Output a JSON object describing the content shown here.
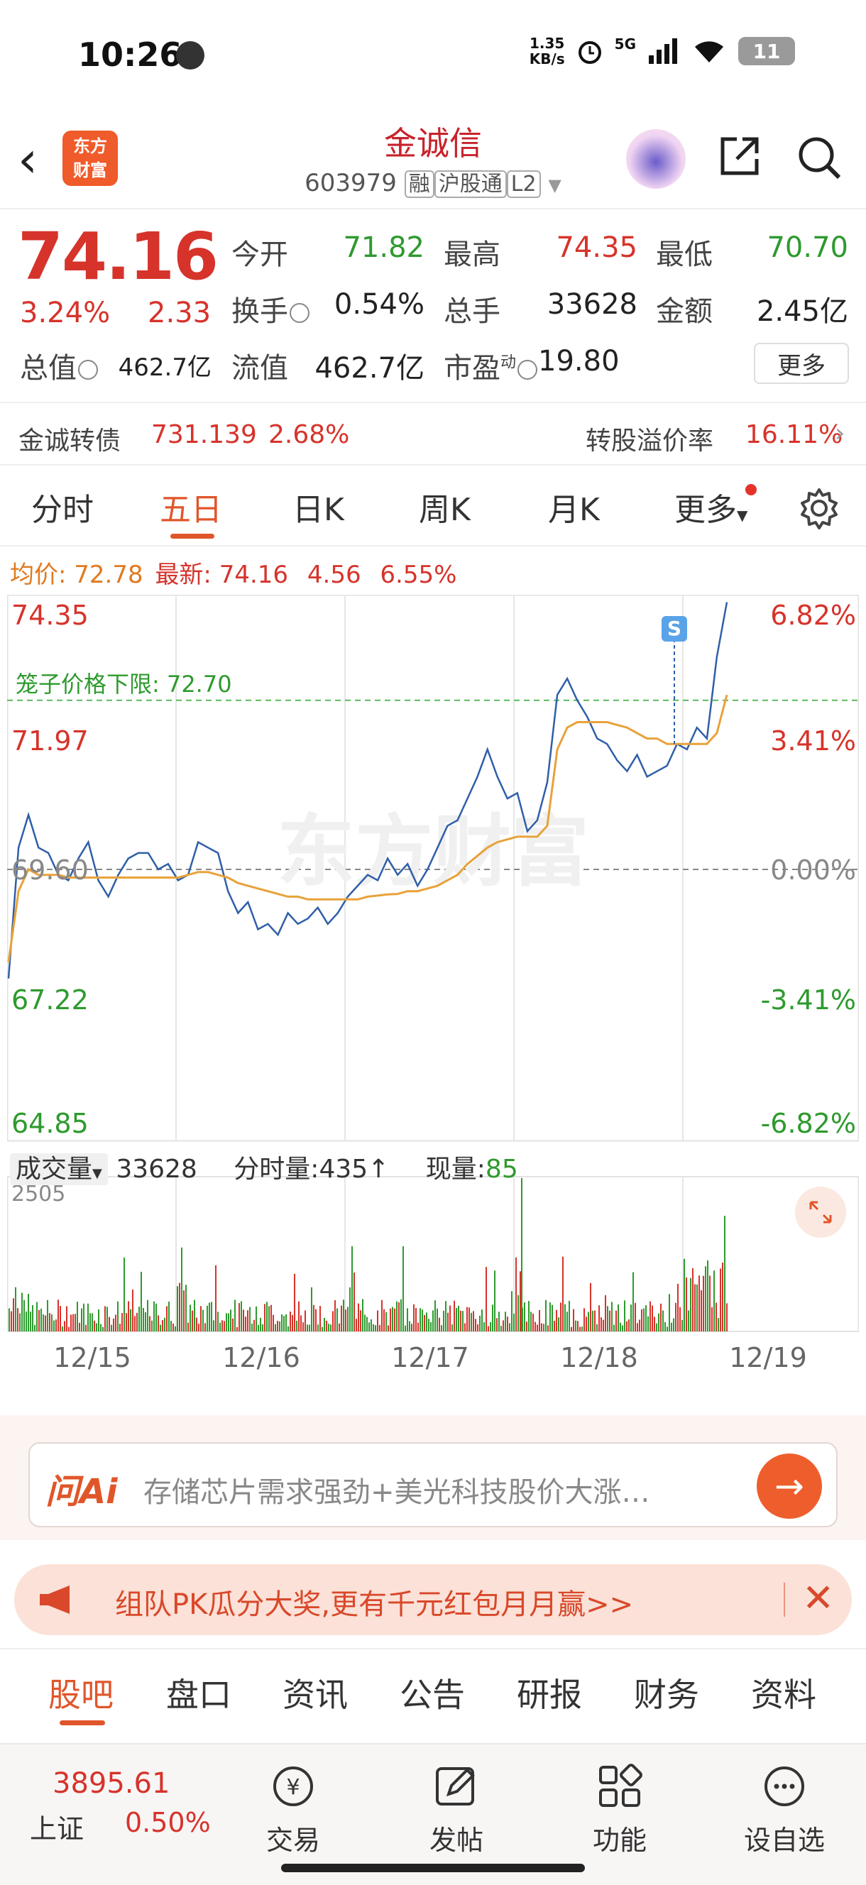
{
  "status_bar": {
    "time": "10:26",
    "net_speed_top": "1.35",
    "net_speed_bottom": "KB/s",
    "signal_label": "5G",
    "battery": "11"
  },
  "header": {
    "logo_line1": "东方",
    "logo_line2": "财富",
    "stock_name": "金诚信",
    "stock_code": "603979",
    "tag_margin": "融",
    "tag_connect": "沪股通",
    "tag_level": "L2"
  },
  "quote": {
    "price": "74.16",
    "change_pct": "3.24%",
    "change_val": "2.33",
    "open_label": "今开",
    "open": "71.82",
    "high_label": "最高",
    "high": "74.35",
    "low_label": "最低",
    "low": "70.70",
    "turnover_label": "换手",
    "turnover": "0.54%",
    "volume_label": "总手",
    "volume": "33628",
    "amount_label": "金额",
    "amount": "2.45亿",
    "mktcap_label": "总值",
    "mktcap": "462.7亿",
    "float_label": "流值",
    "float_cap": "462.7亿",
    "pe_label": "市盈",
    "pe_sup": "动",
    "pe": "19.80",
    "more_label": "更多"
  },
  "bond": {
    "label": "金诚转债",
    "price": "731.139",
    "change": "2.68%",
    "premium_label": "转股溢价率",
    "premium": "16.11%",
    "chevron": "›"
  },
  "tabs": {
    "items": [
      "分时",
      "五日",
      "日K",
      "周K",
      "月K",
      "更多"
    ],
    "active": "五日"
  },
  "avg_line": {
    "avg_label": "均价:",
    "avg": "72.78",
    "latest_label": "最新:",
    "latest": "74.16",
    "chg": "4.56",
    "chg_pct": "6.55%"
  },
  "chart_data": {
    "type": "line",
    "price_axis": [
      "74.35",
      "71.97",
      "69.60",
      "67.22",
      "64.85"
    ],
    "pct_axis": [
      "6.82%",
      "3.41%",
      "0.00%",
      "-3.41%",
      "-6.82%"
    ],
    "ylim": [
      64.85,
      74.35
    ],
    "prev_close": 69.6,
    "limit_label": "笼子价格下限:",
    "limit_value": "72.70",
    "marker": "S",
    "watermark": "东方财富",
    "x_dates": [
      "12/15",
      "12/16",
      "12/17",
      "12/18",
      "12/19"
    ],
    "series": [
      {
        "values": [
          67.6,
          70.0,
          70.6,
          70.0,
          69.9,
          69.5,
          69.4,
          69.8,
          70.1,
          69.4,
          69.1,
          69.5,
          69.8,
          69.9,
          69.9,
          69.6,
          69.7,
          69.4,
          69.5,
          70.1,
          70.0,
          69.9,
          69.2,
          68.8,
          69.0,
          68.5,
          68.6,
          68.4,
          68.8,
          68.6,
          68.7,
          68.9,
          68.6,
          68.8,
          69.1,
          69.3,
          69.5,
          69.4,
          69.8,
          69.5,
          69.7,
          69.3,
          69.6,
          70.0,
          70.4,
          70.5,
          70.9,
          71.3,
          71.8,
          71.3,
          70.9,
          71.0,
          70.3,
          70.5,
          71.2,
          72.8,
          73.1,
          72.7,
          72.4,
          72.0,
          71.9,
          71.6,
          71.4,
          71.7,
          71.3,
          71.4,
          71.5,
          71.9,
          71.8,
          72.2,
          72.0,
          73.5,
          74.5
        ]
      },
      {
        "values": [
          67.9,
          69.2,
          69.6,
          69.5,
          69.5,
          69.5,
          69.45,
          69.45,
          69.45,
          69.45,
          69.45,
          69.45,
          69.45,
          69.45,
          69.45,
          69.45,
          69.45,
          69.45,
          69.5,
          69.55,
          69.55,
          69.5,
          69.45,
          69.35,
          69.3,
          69.25,
          69.2,
          69.15,
          69.1,
          69.1,
          69.05,
          69.05,
          69.05,
          69.05,
          69.05,
          69.05,
          69.1,
          69.12,
          69.14,
          69.15,
          69.2,
          69.2,
          69.25,
          69.3,
          69.4,
          69.5,
          69.7,
          69.85,
          70.0,
          70.1,
          70.15,
          70.2,
          70.2,
          70.2,
          70.4,
          71.8,
          72.2,
          72.3,
          72.3,
          72.3,
          72.3,
          72.25,
          72.2,
          72.1,
          72.0,
          72.0,
          71.9,
          71.9,
          71.9,
          71.9,
          71.9,
          72.1,
          72.8
        ]
      }
    ]
  },
  "volume": {
    "label": "成交量",
    "total": "33628",
    "tick_label": "分时量:",
    "tick": "435",
    "current_label": "现量:",
    "current": "85",
    "max": "2505"
  },
  "ai": {
    "logo": "问Ai",
    "text": "存储芯片需求强劲+美光科技股价大涨…",
    "go": "→"
  },
  "promo": {
    "text": "组队PK瓜分大奖,更有千元红包月月赢>>",
    "close": "✕"
  },
  "bottom_tabs": {
    "items": [
      "股吧",
      "盘口",
      "资讯",
      "公告",
      "研报",
      "财务",
      "资料"
    ],
    "active": "股吧"
  },
  "footer": {
    "index_value": "3895.61",
    "index_name": "上证",
    "index_chg": "0.50%",
    "items": [
      "交易",
      "发帖",
      "功能",
      "设自选"
    ]
  },
  "colors": {
    "up": "#d6332b",
    "down": "#2e9a2e",
    "accent": "#e0562a",
    "avg_line": "#e8a23a",
    "price_line": "#2f5fa8"
  }
}
